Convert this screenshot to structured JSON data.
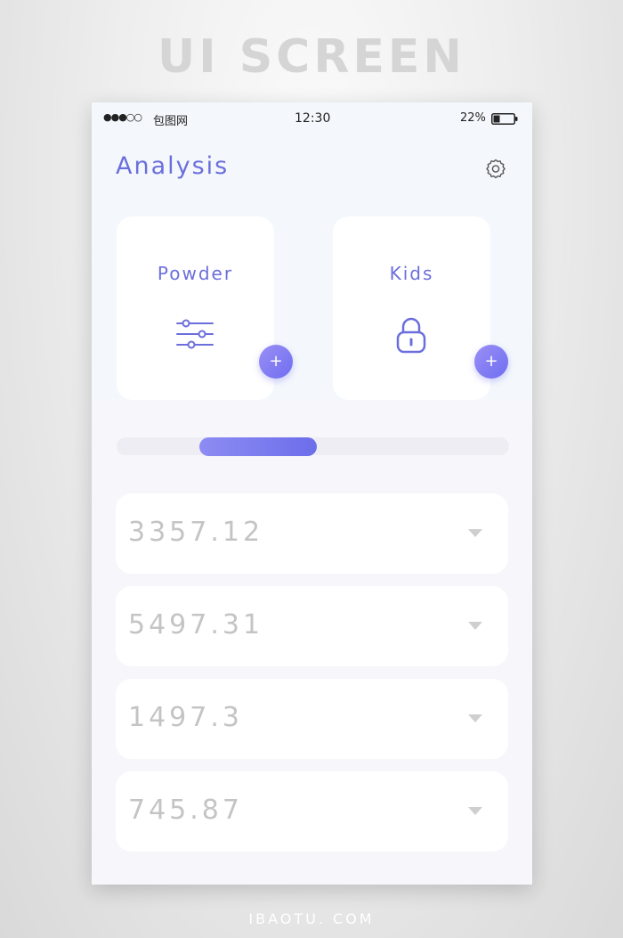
{
  "background": {
    "title": "UI SCREEN",
    "footer": "IBAOTU. COM"
  },
  "status_bar": {
    "signal": "●●●○○",
    "carrier": "包图网",
    "time": "12:30",
    "battery": "22%"
  },
  "header": {
    "title": "Analysis",
    "settings_icon": "gear-icon"
  },
  "cards": [
    {
      "label": "Powder",
      "icon": "sliders-icon",
      "action": "+"
    },
    {
      "label": "Kids",
      "icon": "lock-icon",
      "action": "+"
    }
  ],
  "progress": {
    "start": 0.21,
    "end": 0.51
  },
  "values": [
    "3357.12",
    "5497.31",
    "1497.3",
    "745.87"
  ],
  "colors": {
    "accent": "#6b6fdc",
    "accent_gradient_start": "#9a8ff6",
    "accent_gradient_end": "#6f6ef0",
    "value_text": "#c4c4c4"
  }
}
